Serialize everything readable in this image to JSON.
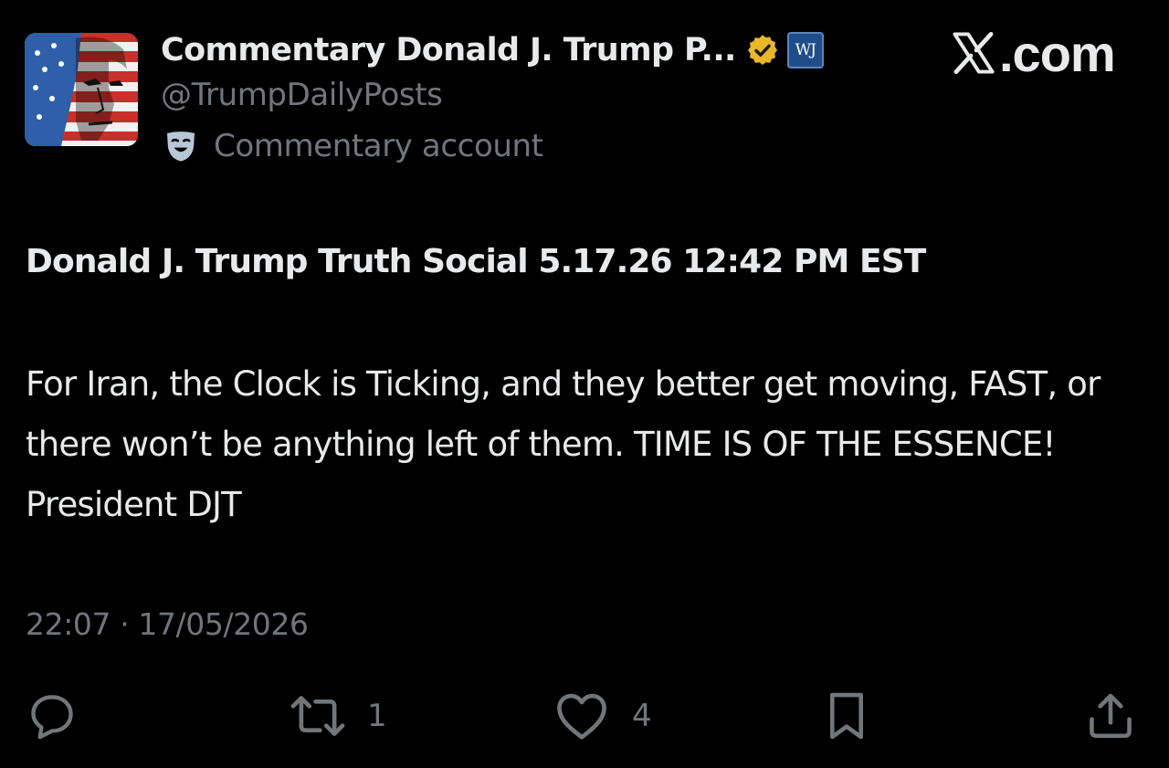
{
  "account": {
    "display_name": "Commentary Donald J. Trump P...",
    "handle": "@TrumpDailyPosts",
    "account_type_label": "Commentary account",
    "affiliate_badge_text": "WJ",
    "verified_icon": "verified-badge-icon",
    "account_type_icon": "theater-mask-icon"
  },
  "branding": {
    "site_suffix": ".com",
    "logo_icon": "x-logo-icon"
  },
  "post": {
    "headline": "Donald J. Trump Truth Social 5.17.26 12:42 PM EST",
    "body": "For Iran, the Clock is Ticking, and they better get moving, FAST, or there won’t be anything left of them. TIME IS OF THE ESSENCE! President DJT",
    "timestamp": "22:07 · 17/05/2026"
  },
  "actions": {
    "reply_icon": "reply-icon",
    "repost_icon": "repost-icon",
    "repost_count": "1",
    "like_icon": "heart-icon",
    "like_count": "4",
    "bookmark_icon": "bookmark-icon",
    "share_icon": "share-icon"
  },
  "colors": {
    "background": "#000000",
    "primary_text": "#e7e9ea",
    "secondary_text": "#71767b",
    "verified_gold": "#e8b829",
    "affiliate_blue": "#1f4d8a"
  }
}
